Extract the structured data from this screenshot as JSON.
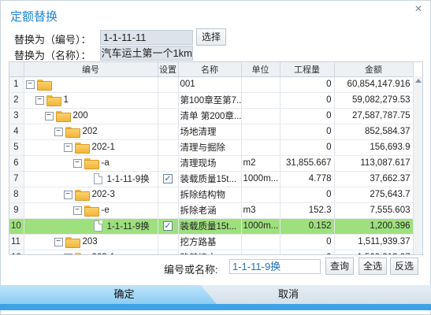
{
  "dialog": {
    "title": "定额替换",
    "close_glyph": "×"
  },
  "replace_code": {
    "label": "替换为（编号）：",
    "value": "1-1-11-11",
    "button": "选择"
  },
  "replace_name": {
    "label": "替换为（名称）：",
    "value": "汽车运土第一个1km"
  },
  "grid": {
    "headers": [
      "编号",
      "设置",
      "名称",
      "单位",
      "工程量",
      "金额"
    ],
    "rows": [
      {
        "idx": "1",
        "code": "",
        "set": "",
        "name": "001",
        "unit": "",
        "qty": "0",
        "amount": "60,854,147.916"
      },
      {
        "idx": "2",
        "code": "1",
        "set": "",
        "name": "第100章至第7...",
        "unit": "",
        "qty": "0",
        "amount": "59,082,279.53"
      },
      {
        "idx": "3",
        "code": "200",
        "set": "",
        "name": "清单  第200章...",
        "unit": "",
        "qty": "0",
        "amount": "27,587,787.75"
      },
      {
        "idx": "4",
        "code": "202",
        "set": "",
        "name": "场地清理",
        "unit": "",
        "qty": "0",
        "amount": "852,584.37"
      },
      {
        "idx": "5",
        "code": "202-1",
        "set": "",
        "name": "清理与掘除",
        "unit": "",
        "qty": "0",
        "amount": "156,693.9"
      },
      {
        "idx": "6",
        "code": "-a",
        "set": "",
        "name": "清理现场",
        "unit": "m2",
        "qty": "31,855.667",
        "amount": "113,087.617"
      },
      {
        "idx": "7",
        "code": "1-1-11-9换",
        "set": "✓",
        "name": "装载质量15t...",
        "unit": "1000m...",
        "qty": "4.778",
        "amount": "37,662.37"
      },
      {
        "idx": "8",
        "code": "202-3",
        "set": "",
        "name": "拆除结构物",
        "unit": "",
        "qty": "0",
        "amount": "275,643.7"
      },
      {
        "idx": "9",
        "code": "-e",
        "set": "",
        "name": "拆除老涵",
        "unit": "m3",
        "qty": "152.3",
        "amount": "7,555.603"
      },
      {
        "idx": "10",
        "code": "1-1-11-9换",
        "set": "✓",
        "name": "装载质量15t...",
        "unit": "1000m...",
        "qty": "0.152",
        "amount": "1,200.396"
      },
      {
        "idx": "11",
        "code": "203",
        "set": "",
        "name": "挖方路基",
        "unit": "",
        "qty": "0",
        "amount": "1,511,939.37"
      },
      {
        "idx": "12",
        "code": "203-1",
        "set": "",
        "name": "路基挖方",
        "unit": "",
        "qty": "0",
        "amount": "1,509,913.07"
      }
    ]
  },
  "search": {
    "label": "编号或名称:",
    "value": "1-1-11-9换",
    "query": "查询",
    "select_all": "全选",
    "invert": "反选"
  },
  "footer": {
    "ok": "确定",
    "cancel": "取消"
  },
  "colors": {
    "accent": "#1d86d6",
    "selected_row": "#9ee07e",
    "bottom_bar": "#3ea3e6"
  }
}
